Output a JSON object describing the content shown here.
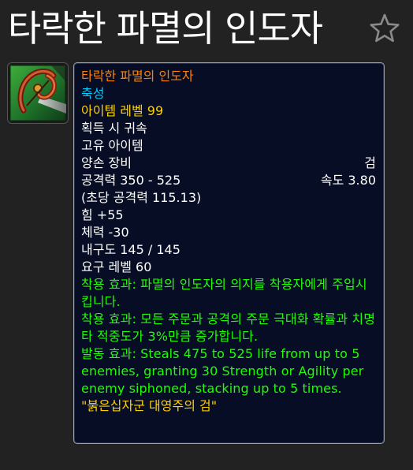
{
  "page": {
    "title": "타락한 파멸의 인도자"
  },
  "icons": {
    "favorite": "star-outline-icon",
    "item": "bow-weapon-item-icon"
  },
  "colors": {
    "background": "#222222",
    "tooltip_bg": "#070d24",
    "legendary": "#ff8000",
    "heirloom_cyan": "#00ccff",
    "item_level": "#ffd100",
    "effect_green": "#1eff00",
    "flavor": "#ffd100"
  },
  "tooltip": {
    "name": "타락한 파멸의 인도자",
    "quality": "축성",
    "item_level_label": "아이템 레벨 ",
    "item_level_value": "99",
    "binding": "획득 시 귀속",
    "unique": "고유 아이템",
    "slot": "양손 장비",
    "weapon_type": "검",
    "damage": "공격력 350 - 525",
    "speed": "속도 3.80",
    "dps": "(초당 공격력 115.13)",
    "stats": [
      "힘 +55",
      "체력 -30"
    ],
    "durability": "내구도 145 / 145",
    "required_level": "요구 레벨 60",
    "effects": [
      "착용 효과: 파멸의 인도자의 의지를 착용자에게 주입시킵니다.",
      "착용 효과: 모든 주문과 공격의 주문 극대화 확률과 치명타 적중도가 3%만큼 증가합니다.",
      "발동 효과: Steals 475 to 525 life from up to 5 enemies, granting 30 Strength or Agility per enemy siphoned, stacking up to 5 times."
    ],
    "flavor": "\"붉은십자군 대영주의 검\""
  }
}
